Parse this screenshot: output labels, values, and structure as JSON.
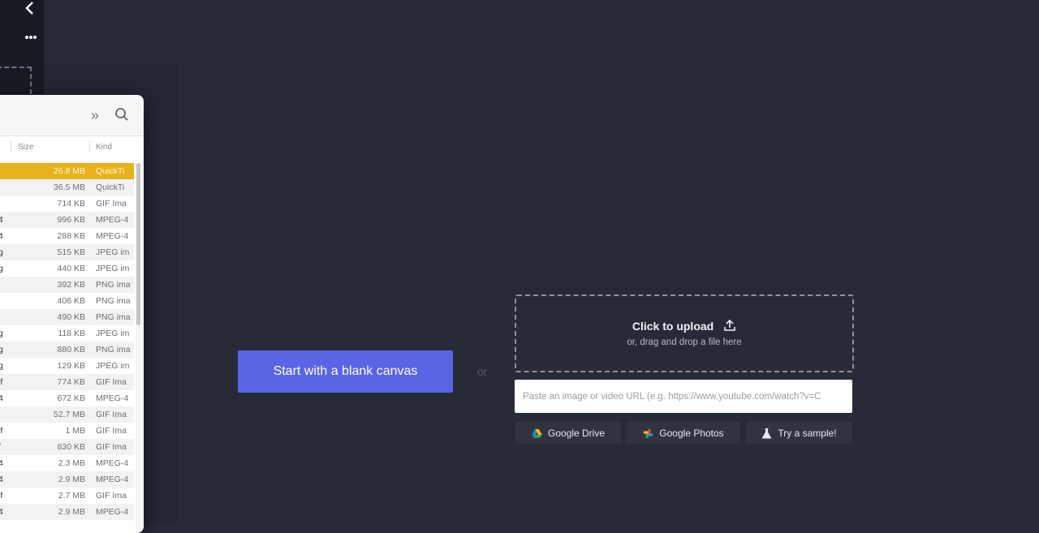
{
  "sidebar": {
    "back_icon": "chevron-left-icon",
    "more_icon": "ellipsis-icon"
  },
  "finder": {
    "toolbar": {
      "more_icon": "double-chevron-right-icon",
      "search_icon": "search-icon"
    },
    "columns": {
      "size": "Size",
      "kind": "Kind"
    },
    "rows": [
      {
        "name": "",
        "size": "26.8 MB",
        "kind": "QuickTi",
        "selected": true
      },
      {
        "name": "",
        "size": "36.5 MB",
        "kind": "QuickTi"
      },
      {
        "name": "",
        "size": "714 KB",
        "kind": "GIF Ima"
      },
      {
        "name": "4",
        "size": "996 KB",
        "kind": "MPEG-4"
      },
      {
        "name": "4",
        "size": "288 KB",
        "kind": "MPEG-4"
      },
      {
        "name": "g",
        "size": "515 KB",
        "kind": "JPEG im"
      },
      {
        "name": "g",
        "size": "440 KB",
        "kind": "JPEG im"
      },
      {
        "name": "",
        "size": "392 KB",
        "kind": "PNG ima"
      },
      {
        "name": "",
        "size": "406 KB",
        "kind": "PNG ima"
      },
      {
        "name": "",
        "size": "490 KB",
        "kind": "PNG ima"
      },
      {
        "name": "g",
        "size": "118 KB",
        "kind": "JPEG im"
      },
      {
        "name": "g",
        "size": "880 KB",
        "kind": "PNG ima"
      },
      {
        "name": "g",
        "size": "129 KB",
        "kind": "JPEG im"
      },
      {
        "name": "if",
        "size": "774 KB",
        "kind": "GIF Ima"
      },
      {
        "name": "4",
        "size": "672 KB",
        "kind": "MPEG-4"
      },
      {
        "name": "",
        "size": "52.7 MB",
        "kind": "GIF Ima"
      },
      {
        "name": "if",
        "size": "1 MB",
        "kind": "GIF Ima"
      },
      {
        "name": "f",
        "size": "830 KB",
        "kind": "GIF Ima"
      },
      {
        "name": "4",
        "size": "2.3 MB",
        "kind": "MPEG-4"
      },
      {
        "name": "4",
        "size": "2.9 MB",
        "kind": "MPEG-4"
      },
      {
        "name": "if",
        "size": "2.7 MB",
        "kind": "GIF Ima"
      },
      {
        "name": "4",
        "size": "2.9 MB",
        "kind": "MPEG-4"
      }
    ]
  },
  "main": {
    "blank_canvas_label": "Start with a blank canvas",
    "or_label": "or",
    "upload": {
      "title": "Click to upload",
      "subtitle": "or, drag and drop a file here",
      "icon": "upload-icon"
    },
    "url_input": {
      "placeholder": "Paste an image or video URL (e.g. https://www.youtube.com/watch?v=C",
      "value": ""
    },
    "sources": [
      {
        "label": "Google Drive",
        "icon": "google-drive-icon"
      },
      {
        "label": "Google Photos",
        "icon": "google-photos-icon"
      },
      {
        "label": "Try a sample!",
        "icon": "flask-icon"
      }
    ]
  },
  "colors": {
    "background": "#262b37",
    "sidebar": "#161a23",
    "accent": "#5b64e4",
    "selected_row": "#e8b21c"
  }
}
